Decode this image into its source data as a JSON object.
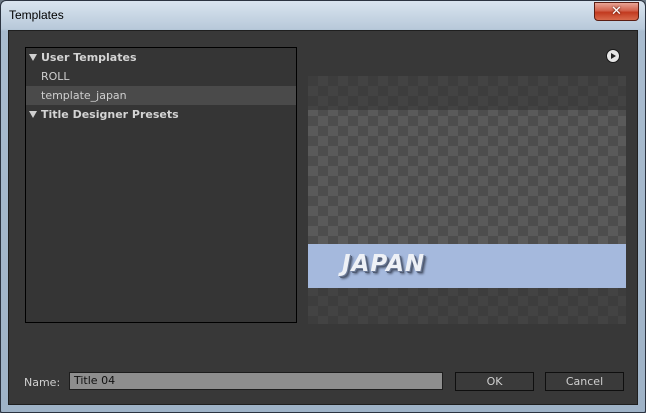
{
  "window": {
    "title": "Templates",
    "close_glyph": "✕"
  },
  "tree": {
    "groups": [
      {
        "label": "User Templates",
        "expanded": true,
        "items": [
          {
            "label": "ROLL",
            "selected": false
          },
          {
            "label": "template_japan",
            "selected": true
          }
        ]
      },
      {
        "label": "Title Designer Presets",
        "expanded": true,
        "items": []
      }
    ]
  },
  "preview": {
    "menu_icon": "play-circle-icon",
    "title_text": "JAPAN",
    "banner_color": "#a5b9dd"
  },
  "form": {
    "name_label": "Name:",
    "name_value": "Title 04",
    "ok_label": "OK",
    "cancel_label": "Cancel"
  }
}
